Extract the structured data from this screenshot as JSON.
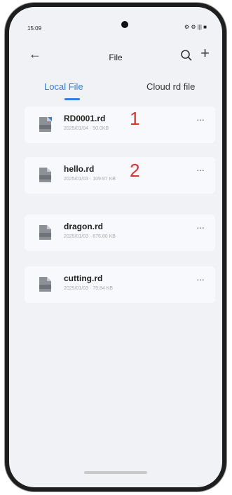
{
  "status_bar": {
    "time": "15:09",
    "right": "⚙ ⚙ ||| ■"
  },
  "header": {
    "title": "File"
  },
  "tabs": [
    {
      "label": "Local File",
      "active": true
    },
    {
      "label": "Cloud rd file",
      "active": false
    }
  ],
  "files": [
    {
      "name": "RD0001.rd",
      "meta": "2025/01/04 · 50.0KB",
      "more": "···"
    },
    {
      "name": "hello.rd",
      "meta": "2025/01/03 · 109.87 KB",
      "more": "···"
    },
    {
      "name": "dragon.rd",
      "meta": "2025/01/03 · 676.80 KB",
      "more": "···"
    },
    {
      "name": "cutting.rd",
      "meta": "2025/01/03 · 79.84 KB",
      "more": "···"
    }
  ],
  "annotations": [
    {
      "text": "1",
      "color": "#e0322c"
    },
    {
      "text": "2",
      "color": "#e0322c"
    }
  ],
  "colors": {
    "accent": "#2f7de8",
    "annotation": "#e0322c"
  }
}
